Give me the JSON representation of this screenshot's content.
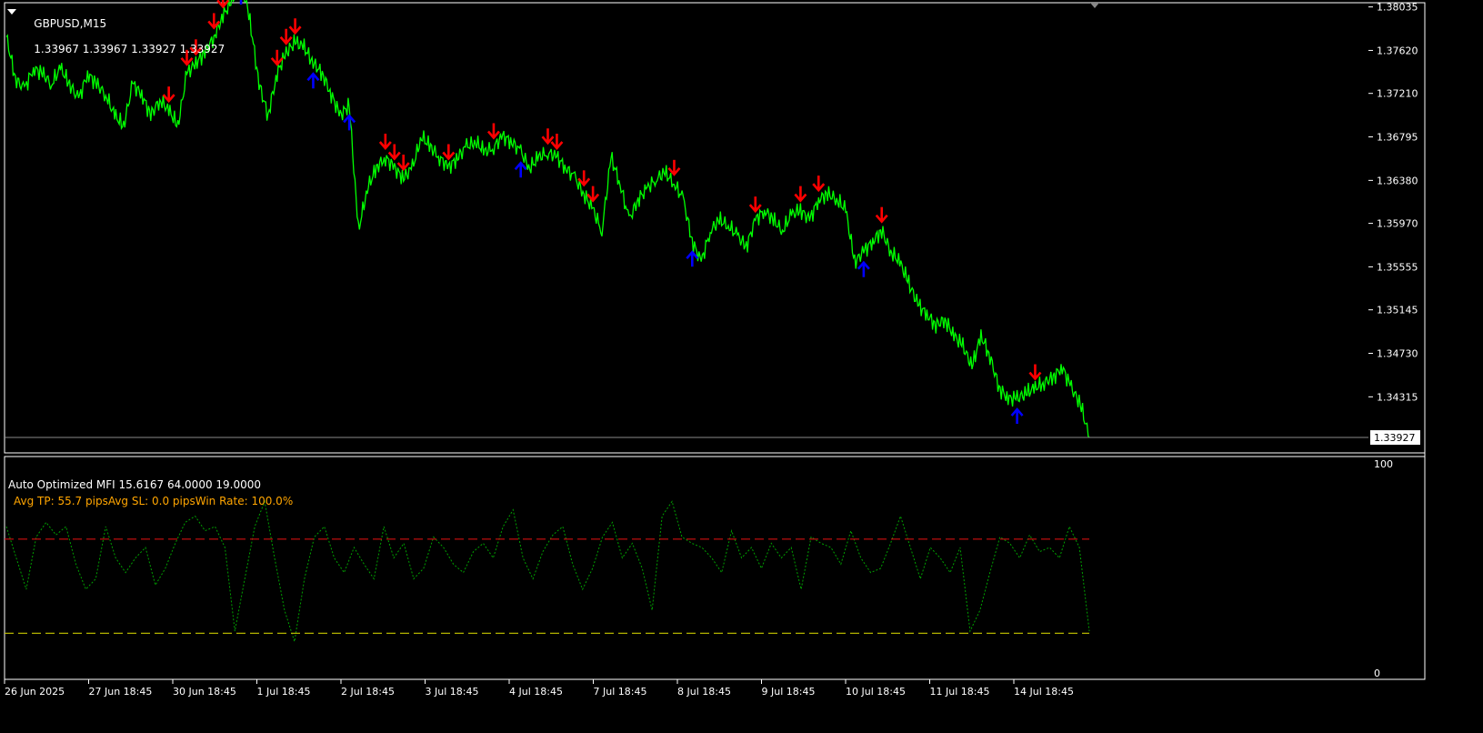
{
  "header": {
    "symbol": "GBPUSD,M15",
    "ohlc": "1.33967 1.33967 1.33927 1.33927"
  },
  "indicator": {
    "title": "Auto Optimized MFI 15.6167 64.0000 19.0000",
    "stats": "Avg TP: 55.7 pipsAvg SL: 0.0 pipsWin Rate: 100.0%"
  },
  "colors": {
    "price": "#00ff00",
    "buy": "#0000ff",
    "sell": "#ff0000",
    "mfi": "#00a000",
    "upper_level": "#d01010",
    "lower_level": "#c8c800",
    "frame": "#ffffff",
    "background": "#000000",
    "stats_text": "#ffa500"
  },
  "chart_data": [
    {
      "type": "line",
      "name": "price-chart",
      "series": [
        {
          "values": [
            1.3775,
            1.3735,
            1.3725,
            1.3745,
            1.374,
            1.373,
            1.3745,
            1.373,
            1.3715,
            1.374,
            1.373,
            1.372,
            1.37,
            1.369,
            1.373,
            1.372,
            1.37,
            1.3715,
            1.3705,
            1.369,
            1.374,
            1.375,
            1.376,
            1.3775,
            1.3795,
            1.381,
            1.383,
            1.379,
            1.373,
            1.37,
            1.374,
            1.376,
            1.377,
            1.3765,
            1.375,
            1.374,
            1.372,
            1.37,
            1.371,
            1.359,
            1.363,
            1.365,
            1.366,
            1.365,
            1.364,
            1.365,
            1.368,
            1.367,
            1.366,
            1.365,
            1.366,
            1.367,
            1.3675,
            1.3665,
            1.367,
            1.368,
            1.3675,
            1.3665,
            1.365,
            1.366,
            1.3665,
            1.366,
            1.365,
            1.364,
            1.3625,
            1.361,
            1.359,
            1.366,
            1.3635,
            1.36,
            1.362,
            1.363,
            1.364,
            1.3645,
            1.3635,
            1.362,
            1.358,
            1.356,
            1.359,
            1.36,
            1.3595,
            1.3585,
            1.3575,
            1.36,
            1.361,
            1.36,
            1.359,
            1.3605,
            1.361,
            1.36,
            1.362,
            1.3625,
            1.362,
            1.361,
            1.356,
            1.357,
            1.358,
            1.359,
            1.357,
            1.356,
            1.354,
            1.352,
            1.351,
            1.35,
            1.3505,
            1.349,
            1.348,
            1.346,
            1.349,
            1.347,
            1.344,
            1.343,
            1.343,
            1.3435,
            1.344,
            1.3445,
            1.345,
            1.346,
            1.344,
            1.3425,
            1.3393
          ]
        }
      ],
      "ylim": [
        1.3378,
        1.38075
      ],
      "ytick_labels": [
        "1.38035",
        "1.37620",
        "1.37210",
        "1.36795",
        "1.36380",
        "1.35970",
        "1.35555",
        "1.35145",
        "1.34730",
        "1.34315"
      ],
      "current_price_label": "1.33927",
      "buy_signal_indices": [
        26,
        34,
        38,
        57,
        76,
        95,
        112
      ],
      "sell_signal_indices": [
        18,
        20,
        21,
        23,
        24,
        30,
        31,
        32,
        42,
        43,
        44,
        49,
        54,
        60,
        61,
        64,
        65,
        74,
        83,
        88,
        90,
        97,
        114
      ]
    },
    {
      "type": "line",
      "name": "mfi-chart",
      "series": [
        {
          "name": "Auto Optimized MFI",
          "values": [
            70,
            55,
            40,
            65,
            72,
            66,
            70,
            52,
            40,
            45,
            70,
            55,
            48,
            55,
            60,
            42,
            50,
            62,
            72,
            75,
            68,
            70,
            60,
            20,
            45,
            70,
            82,
            55,
            30,
            15,
            45,
            65,
            70,
            55,
            48,
            60,
            52,
            45,
            70,
            55,
            62,
            45,
            50,
            65,
            60,
            52,
            48,
            58,
            62,
            55,
            70,
            78,
            55,
            45,
            58,
            66,
            70,
            52,
            40,
            50,
            65,
            72,
            55,
            62,
            50,
            30,
            75,
            82,
            65,
            62,
            60,
            55,
            48,
            68,
            55,
            60,
            50,
            62,
            55,
            60,
            40,
            65,
            62,
            60,
            52,
            68,
            55,
            48,
            50,
            62,
            75,
            60,
            45,
            60,
            55,
            48,
            60,
            20,
            30,
            48,
            65,
            62,
            55,
            66,
            58,
            60,
            55,
            70,
            60,
            20
          ]
        },
        {
          "name": "upper-level",
          "values": [
            64
          ]
        },
        {
          "name": "lower-level",
          "values": [
            19
          ]
        }
      ],
      "ylim": [
        0,
        100
      ],
      "ytick_labels": [
        "100",
        "0"
      ]
    }
  ],
  "xaxis": {
    "tick_labels": [
      "26 Jun 2025",
      "27 Jun 18:45",
      "30 Jun 18:45",
      "1 Jul 18:45",
      "2 Jul 18:45",
      "3 Jul 18:45",
      "4 Jul 18:45",
      "7 Jul 18:45",
      "8 Jul 18:45",
      "9 Jul 18:45",
      "10 Jul 18:45",
      "11 Jul 18:45",
      "14 Jul 18:45"
    ]
  }
}
